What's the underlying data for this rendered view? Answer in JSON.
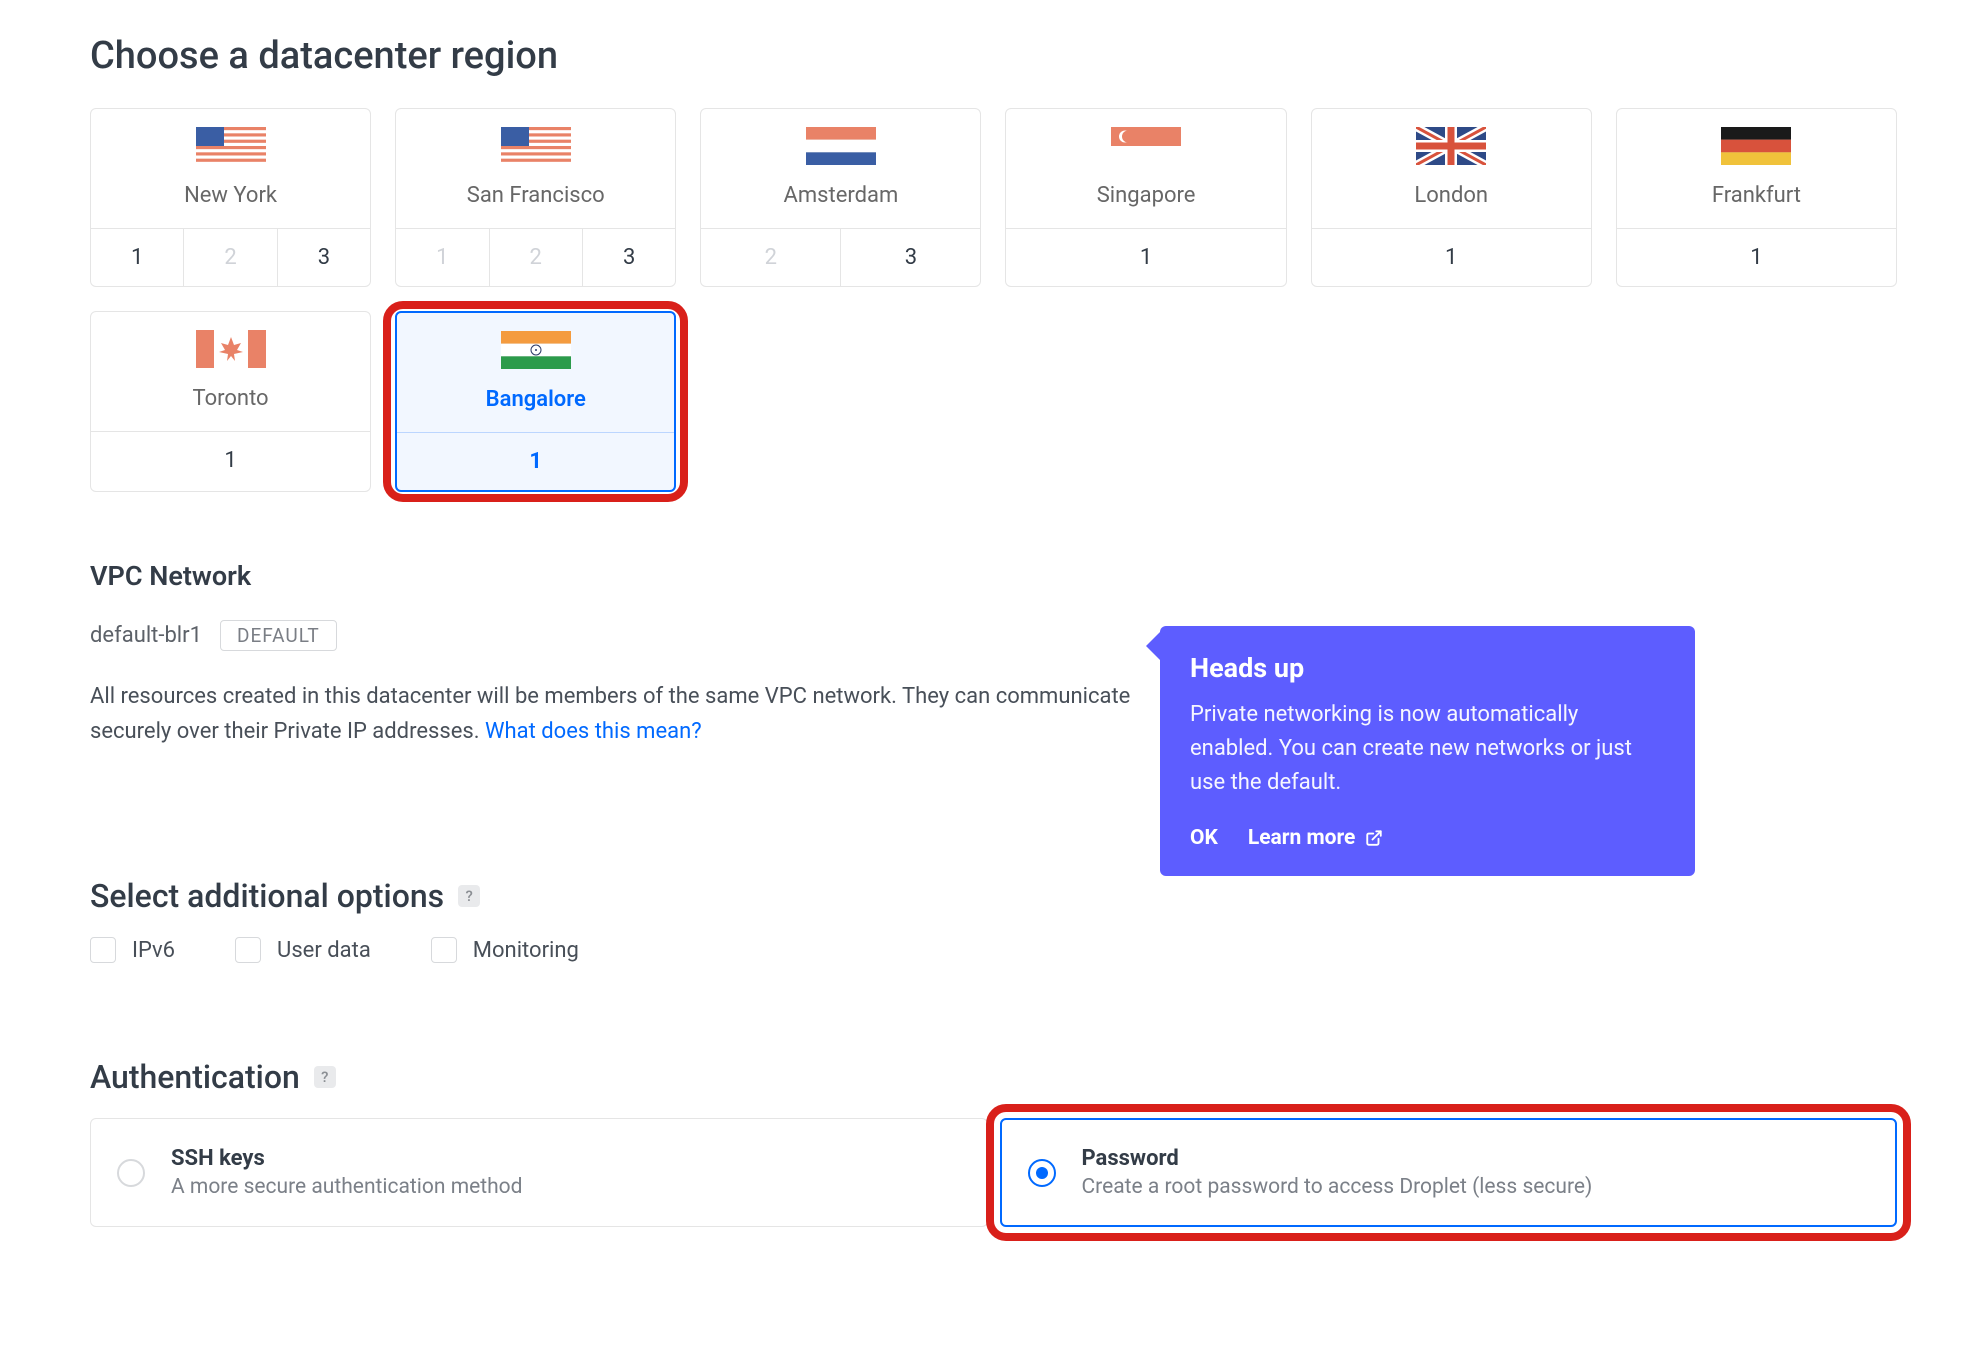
{
  "datacenter": {
    "title": "Choose a datacenter region",
    "regions": [
      {
        "name": "New York",
        "flag": "us",
        "numbers": [
          {
            "v": "1",
            "d": false
          },
          {
            "v": "2",
            "d": true
          },
          {
            "v": "3",
            "d": false
          }
        ],
        "selected": false
      },
      {
        "name": "San Francisco",
        "flag": "us",
        "numbers": [
          {
            "v": "1",
            "d": true
          },
          {
            "v": "2",
            "d": true
          },
          {
            "v": "3",
            "d": false
          }
        ],
        "selected": false
      },
      {
        "name": "Amsterdam",
        "flag": "nl",
        "numbers": [
          {
            "v": "2",
            "d": true
          },
          {
            "v": "3",
            "d": false
          }
        ],
        "selected": false
      },
      {
        "name": "Singapore",
        "flag": "sg",
        "numbers": [
          {
            "v": "1",
            "d": false
          }
        ],
        "selected": false
      },
      {
        "name": "London",
        "flag": "uk",
        "numbers": [
          {
            "v": "1",
            "d": false
          }
        ],
        "selected": false
      },
      {
        "name": "Frankfurt",
        "flag": "de",
        "numbers": [
          {
            "v": "1",
            "d": false
          }
        ],
        "selected": false
      },
      {
        "name": "Toronto",
        "flag": "ca",
        "numbers": [
          {
            "v": "1",
            "d": false
          }
        ],
        "selected": false
      },
      {
        "name": "Bangalore",
        "flag": "in",
        "numbers": [
          {
            "v": "1",
            "d": false
          }
        ],
        "selected": true
      }
    ]
  },
  "vpc": {
    "title": "VPC Network",
    "name": "default-blr1",
    "badge": "DEFAULT",
    "desc_prefix": "All resources created in this datacenter will be members of the same VPC network. They can communicate securely over their Private IP addresses. ",
    "desc_link": "What does this mean?"
  },
  "headsup": {
    "title": "Heads up",
    "body": "Private networking is now automatically enabled. You can create new networks or just use the default.",
    "ok": "OK",
    "learn": "Learn more"
  },
  "options": {
    "title": "Select additional options",
    "items": [
      "IPv6",
      "User data",
      "Monitoring"
    ]
  },
  "auth": {
    "title": "Authentication",
    "cards": [
      {
        "title": "SSH keys",
        "sub": "A more secure authentication method",
        "selected": false
      },
      {
        "title": "Password",
        "sub": "Create a root password to access Droplet (less secure)",
        "selected": true
      }
    ]
  }
}
